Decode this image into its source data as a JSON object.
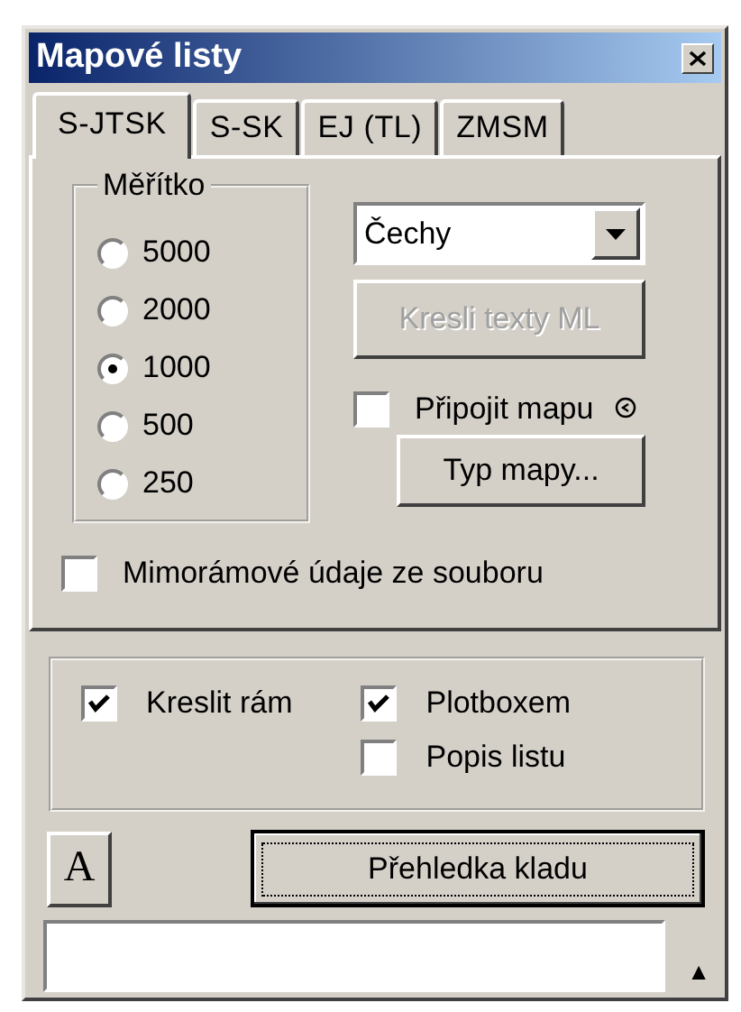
{
  "window": {
    "title": "Mapové listy"
  },
  "tabs": [
    {
      "label": "S-JTSK",
      "selected": true
    },
    {
      "label": "S-SK",
      "selected": false
    },
    {
      "label": "EJ (TL)",
      "selected": false
    },
    {
      "label": "ZMSM",
      "selected": false
    }
  ],
  "scale_group": {
    "title": "Měřítko",
    "options": [
      {
        "label": "5000",
        "selected": false
      },
      {
        "label": "2000",
        "selected": false
      },
      {
        "label": "1000",
        "selected": true
      },
      {
        "label": "500",
        "selected": false
      },
      {
        "label": "250",
        "selected": false
      }
    ]
  },
  "region_select": {
    "value": "Čechy"
  },
  "draw_texts_button": {
    "label": "Kresli texty ML",
    "disabled": true
  },
  "attach_map": {
    "label": "Připojit mapu",
    "checked": false
  },
  "map_type_button": {
    "label": "Typ mapy...",
    "disabled": false
  },
  "extra_data": {
    "label": "Mimorámové údaje ze souboru",
    "checked": false
  },
  "frame_options": [
    [
      {
        "label": "Kreslit rám",
        "checked": true
      }
    ],
    [
      {
        "label": "Plotboxem",
        "checked": true
      },
      {
        "label": "Popis listu",
        "checked": false
      }
    ]
  ],
  "font_button": {
    "label": "A"
  },
  "overview_button": {
    "label": "Přehledka kladu",
    "focused": true
  },
  "expand_arrow": "▲"
}
